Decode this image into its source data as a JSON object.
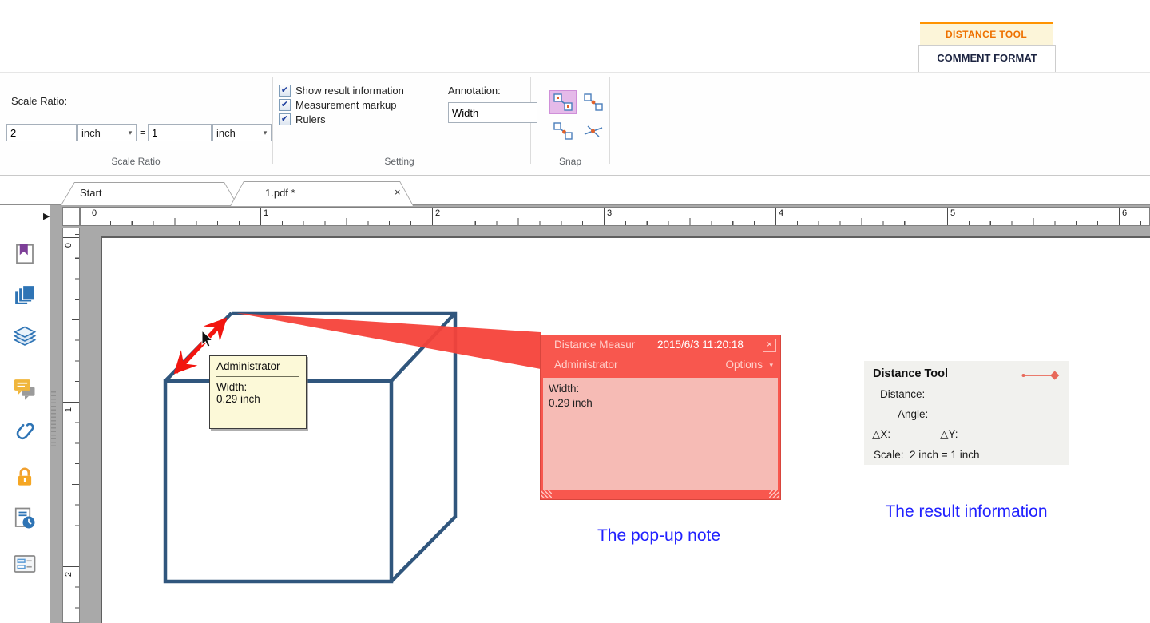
{
  "app": {
    "contextual_tab": "DISTANCE TOOL",
    "ribbon_tab": "COMMENT FORMAT"
  },
  "ribbon": {
    "scale_ratio": {
      "label": "Scale Ratio:",
      "value_left": "2",
      "unit_left": "inch",
      "equals": "=",
      "value_right": "1",
      "unit_right": "inch",
      "group_label": "Scale Ratio"
    },
    "setting": {
      "checkbox_show_result": "Show result information",
      "checkbox_measurement_markup": "Measurement markup",
      "checkbox_rulers": "Rulers",
      "check_glyph": "✔",
      "annotation_label": "Annotation:",
      "annotation_value": "Width",
      "group_label": "Setting"
    },
    "snap": {
      "group_label": "Snap",
      "icons": [
        "snap-endpoint-icon",
        "snap-midpoint-icon",
        "snap-nearest-icon",
        "snap-intersection-icon"
      ]
    }
  },
  "doc_tabs": {
    "start_tab": "Start",
    "active_tab": "1.pdf *",
    "close": "×"
  },
  "rulers": {
    "horizontal": [
      "0",
      "1",
      "2",
      "3",
      "4",
      "5",
      "6"
    ],
    "vertical": [
      "0",
      "1",
      "2"
    ]
  },
  "sidebar": {
    "icons": [
      "bookmarks-icon",
      "pages-icon",
      "layers-icon",
      "comments-icon",
      "attachments-icon",
      "security-icon",
      "signature-doc-icon",
      "form-fields-icon"
    ]
  },
  "tooltip": {
    "author": "Administrator",
    "field": "Width:",
    "value": "0.29 inch"
  },
  "popup_note": {
    "title": "Distance Measur",
    "timestamp": "2015/6/3 11:20:18",
    "close": "×",
    "author": "Administrator",
    "options": "Options",
    "field": "Width:",
    "value": "0.29 inch"
  },
  "result_panel": {
    "title": "Distance Tool",
    "distance": "Distance:",
    "angle": "Angle:",
    "dx": "△X:",
    "dy": "△Y:",
    "scale": "Scale:  2 inch = 1 inch"
  },
  "captions": {
    "popup": "The pop-up note",
    "result": "The result information"
  },
  "colors": {
    "accent_red": "#f8574e",
    "popup_body": "#f6bbb5",
    "cube_blue": "#30567d",
    "caption_blue": "#2121ff",
    "tab_orange": "#ee7100",
    "snap_selected": "#e5bae9"
  }
}
